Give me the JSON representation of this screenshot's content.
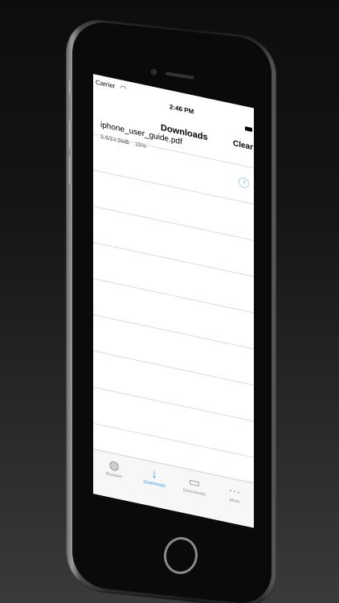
{
  "status_bar": {
    "carrier": "Carrier",
    "time": "2:46 PM"
  },
  "nav": {
    "title": "Downloads",
    "clear_label": "Clear"
  },
  "downloads": [
    {
      "name": "iphone_user_guide.pdf",
      "size": "3.6/24.5MB",
      "progress_label": "15%",
      "progress": 0.15
    }
  ],
  "tabs": [
    {
      "label": "Browser",
      "icon": "globe-icon",
      "active": false
    },
    {
      "label": "Downloads",
      "icon": "download-arrow-icon",
      "active": true
    },
    {
      "label": "Documents",
      "icon": "folder-icon",
      "active": false
    },
    {
      "label": "More",
      "icon": "more-dots-icon",
      "active": false
    }
  ],
  "colors": {
    "accent": "#2e9bff",
    "background": "#111111"
  }
}
